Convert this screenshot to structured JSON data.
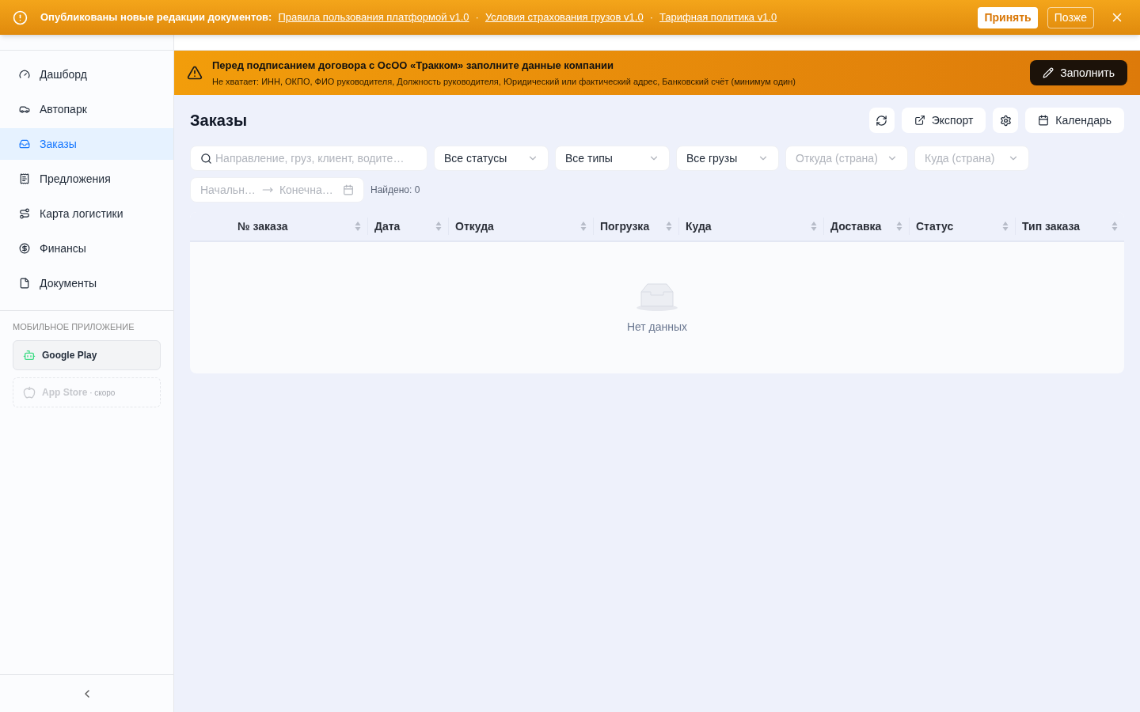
{
  "notice": {
    "title": "Опубликованы новые редакции документов:",
    "links": [
      "Правила пользования платформой v1.0",
      "Условия страхования грузов v1.0",
      "Тарифная политика v1.0"
    ],
    "separator": "·",
    "accept": "Принять",
    "later": "Позже"
  },
  "sidebar": {
    "items": [
      {
        "label": "Дашборд",
        "selected": false
      },
      {
        "label": "Автопарк",
        "selected": false
      },
      {
        "label": "Заказы",
        "selected": true
      },
      {
        "label": "Предложения",
        "selected": false
      },
      {
        "label": "Карта логистики",
        "selected": false
      },
      {
        "label": "Финансы",
        "selected": false
      },
      {
        "label": "Документы",
        "selected": false
      }
    ],
    "mobile_heading": "МОБИЛЬНОЕ ПРИЛОЖЕНИЕ",
    "stores": [
      {
        "label": "Google Play",
        "disabled": false
      },
      {
        "label": "App Store",
        "note": "· скоро",
        "disabled": true
      }
    ]
  },
  "warning": {
    "title": "Перед подписанием договора с ОсОО «Тракком» заполните данные компании",
    "text": "Не хватает: ИНН, ОКПО, ФИО руководителя, Должность руководителя, Юридический или фактический адрес, Банковский счёт (минимум один)",
    "button": "Заполнить"
  },
  "page": {
    "title": "Заказы",
    "export": "Экспорт",
    "calendar": "Календарь"
  },
  "filters": {
    "search_placeholder": "Направление, груз, клиент, водите…",
    "selects": [
      {
        "value": "Все статусы"
      },
      {
        "value": "Все типы"
      },
      {
        "value": "Все грузы"
      },
      {
        "placeholder": "Откуда (страна)"
      },
      {
        "placeholder": "Куда (страна)"
      }
    ],
    "date_start": "Начальн…",
    "date_end": "Конечна…",
    "found": "Найдено: 0"
  },
  "table": {
    "columns": [
      "№ заказа",
      "Дата",
      "Откуда",
      "Погрузка",
      "Куда",
      "Доставка",
      "Статус",
      "Тип заказа"
    ],
    "empty": "Нет данных"
  }
}
